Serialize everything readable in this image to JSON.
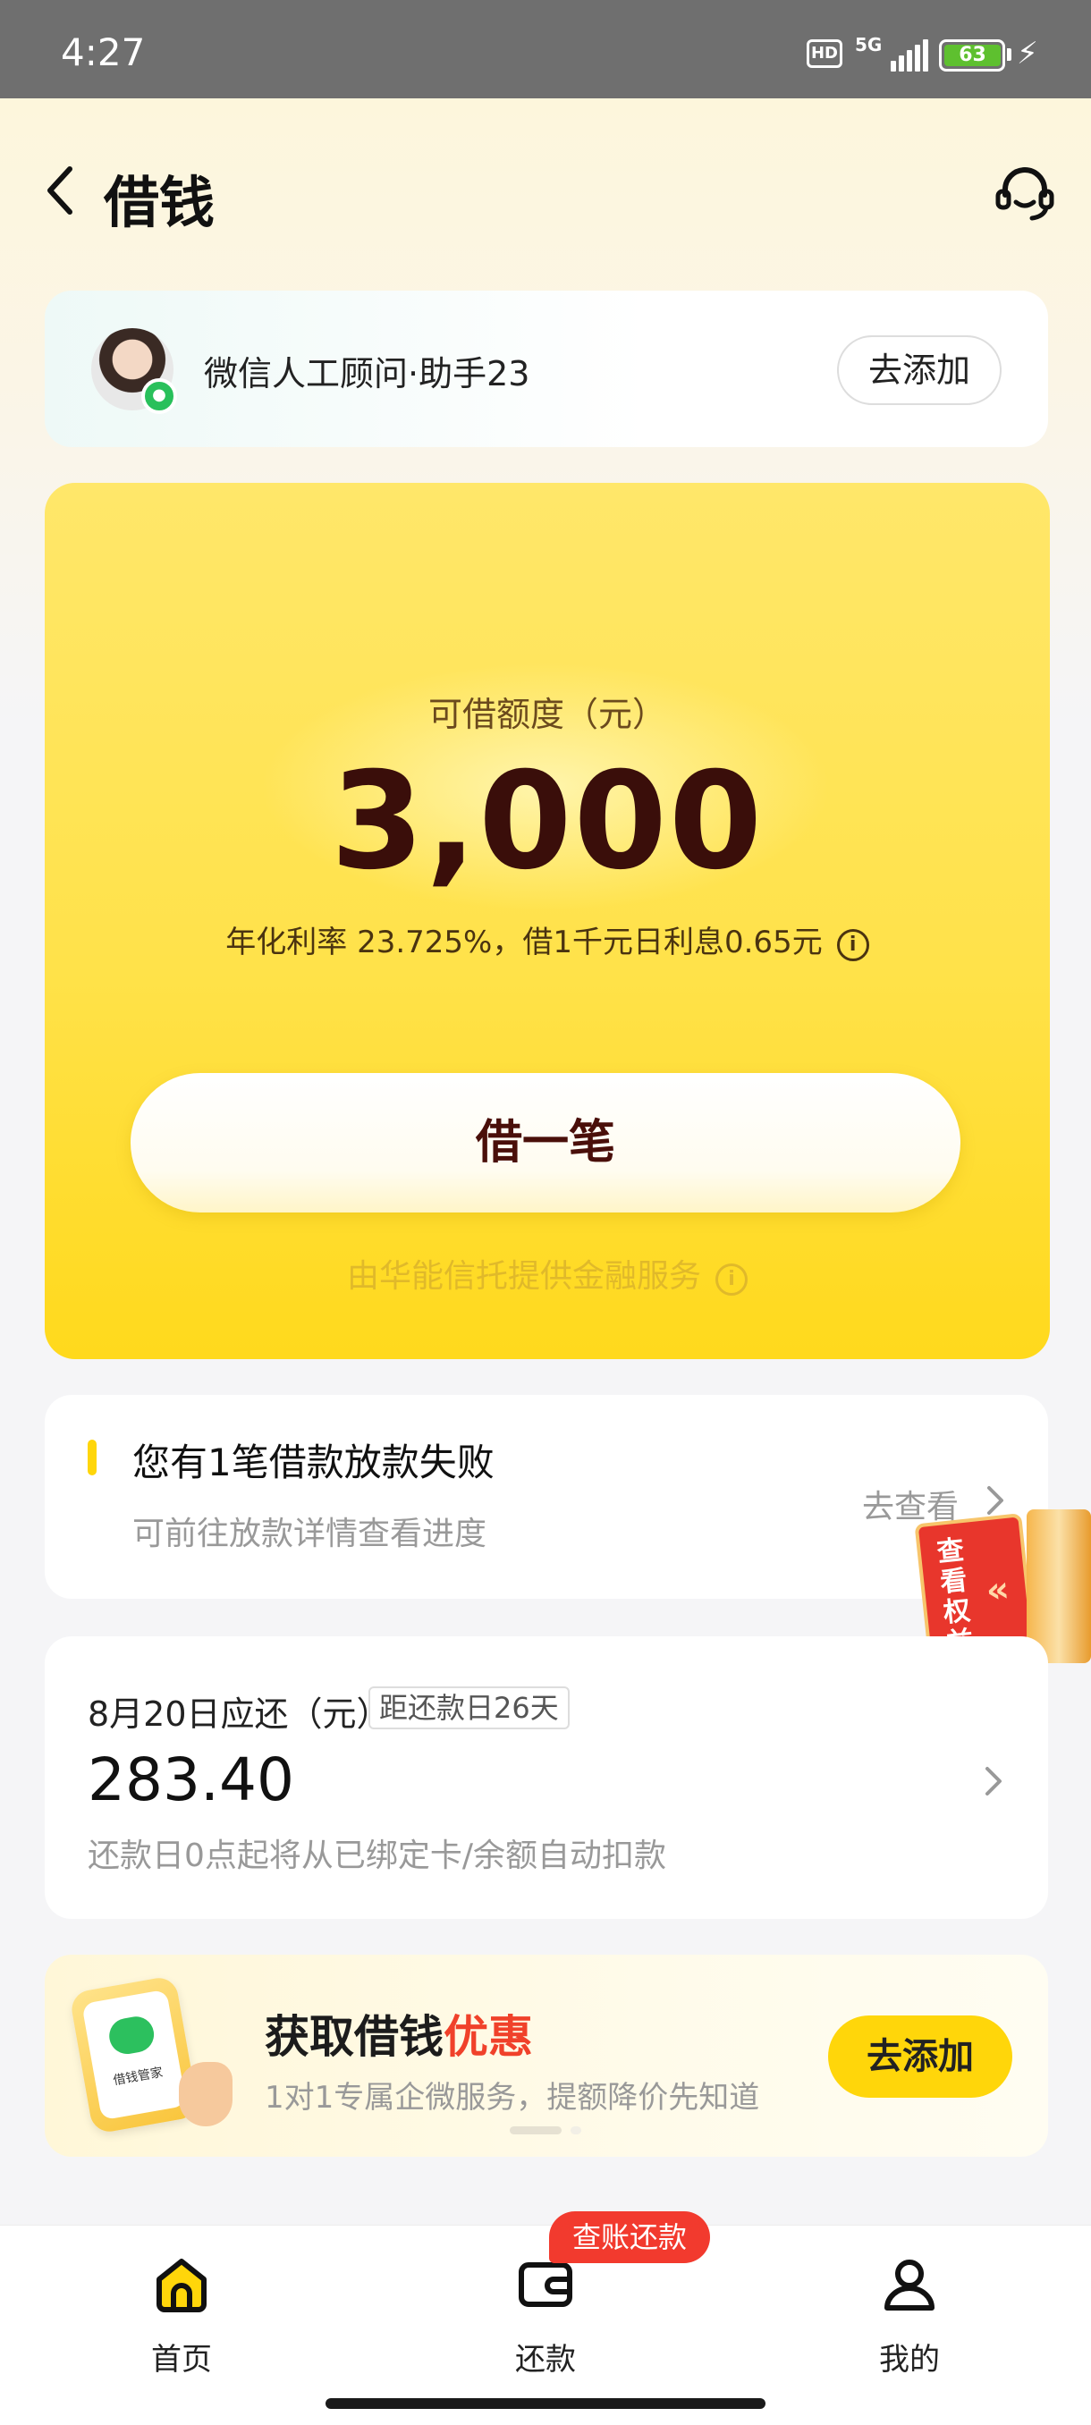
{
  "status_bar": {
    "time": "4:27",
    "hd": "HD",
    "network": "5G",
    "battery": "63"
  },
  "header": {
    "title": "借钱"
  },
  "wechat_card": {
    "label": "微信人工顾问·助手23",
    "button": "去添加"
  },
  "hero": {
    "quota_label": "可借额度（元）",
    "quota_amount": "3,000",
    "rate_text": "年化利率 23.725%，借1千元日利息0.65元",
    "borrow_button": "借一笔",
    "provider_text": "由华能信托提供金融服务"
  },
  "notice": {
    "title": "您有1笔借款放款失败",
    "subtitle": "可前往放款详情查看进度",
    "link": "去查看"
  },
  "perk_tab": {
    "label": "查看权益"
  },
  "repayment": {
    "date_label": "8月20日应还（元）",
    "days_left": "距还款日26天",
    "amount": "283.40",
    "note": "还款日0点起将从已绑定卡/余额自动扣款"
  },
  "promo": {
    "title_main": "获取借钱",
    "title_highlight": "优惠",
    "subtitle": "1对1专属企微服务，提额降价先知道",
    "button": "去添加",
    "phone_label": "借钱管家"
  },
  "bottom_nav": {
    "items": [
      {
        "label": "首页",
        "icon": "home-icon",
        "active": true
      },
      {
        "label": "还款",
        "icon": "wallet-icon",
        "active": false
      },
      {
        "label": "我的",
        "icon": "profile-icon",
        "active": false
      }
    ],
    "badge": "查账还款"
  },
  "colors": {
    "brand_yellow": "#ffd60a",
    "deep_brown": "#3a0e0a",
    "alert_red": "#f23a2e",
    "wechat_green": "#29c05b"
  }
}
